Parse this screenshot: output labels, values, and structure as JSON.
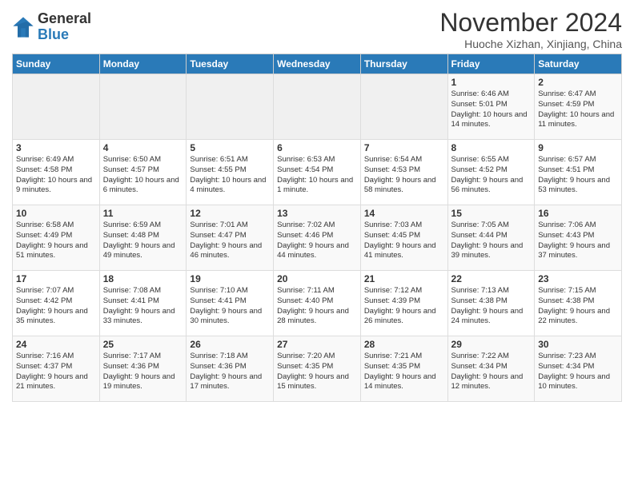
{
  "logo": {
    "general": "General",
    "blue": "Blue"
  },
  "title": "November 2024",
  "subtitle": "Huoche Xizhan, Xinjiang, China",
  "days_of_week": [
    "Sunday",
    "Monday",
    "Tuesday",
    "Wednesday",
    "Thursday",
    "Friday",
    "Saturday"
  ],
  "weeks": [
    [
      {
        "day": "",
        "info": ""
      },
      {
        "day": "",
        "info": ""
      },
      {
        "day": "",
        "info": ""
      },
      {
        "day": "",
        "info": ""
      },
      {
        "day": "",
        "info": ""
      },
      {
        "day": "1",
        "info": "Sunrise: 6:46 AM\nSunset: 5:01 PM\nDaylight: 10 hours and 14 minutes."
      },
      {
        "day": "2",
        "info": "Sunrise: 6:47 AM\nSunset: 4:59 PM\nDaylight: 10 hours and 11 minutes."
      }
    ],
    [
      {
        "day": "3",
        "info": "Sunrise: 6:49 AM\nSunset: 4:58 PM\nDaylight: 10 hours and 9 minutes."
      },
      {
        "day": "4",
        "info": "Sunrise: 6:50 AM\nSunset: 4:57 PM\nDaylight: 10 hours and 6 minutes."
      },
      {
        "day": "5",
        "info": "Sunrise: 6:51 AM\nSunset: 4:55 PM\nDaylight: 10 hours and 4 minutes."
      },
      {
        "day": "6",
        "info": "Sunrise: 6:53 AM\nSunset: 4:54 PM\nDaylight: 10 hours and 1 minute."
      },
      {
        "day": "7",
        "info": "Sunrise: 6:54 AM\nSunset: 4:53 PM\nDaylight: 9 hours and 58 minutes."
      },
      {
        "day": "8",
        "info": "Sunrise: 6:55 AM\nSunset: 4:52 PM\nDaylight: 9 hours and 56 minutes."
      },
      {
        "day": "9",
        "info": "Sunrise: 6:57 AM\nSunset: 4:51 PM\nDaylight: 9 hours and 53 minutes."
      }
    ],
    [
      {
        "day": "10",
        "info": "Sunrise: 6:58 AM\nSunset: 4:49 PM\nDaylight: 9 hours and 51 minutes."
      },
      {
        "day": "11",
        "info": "Sunrise: 6:59 AM\nSunset: 4:48 PM\nDaylight: 9 hours and 49 minutes."
      },
      {
        "day": "12",
        "info": "Sunrise: 7:01 AM\nSunset: 4:47 PM\nDaylight: 9 hours and 46 minutes."
      },
      {
        "day": "13",
        "info": "Sunrise: 7:02 AM\nSunset: 4:46 PM\nDaylight: 9 hours and 44 minutes."
      },
      {
        "day": "14",
        "info": "Sunrise: 7:03 AM\nSunset: 4:45 PM\nDaylight: 9 hours and 41 minutes."
      },
      {
        "day": "15",
        "info": "Sunrise: 7:05 AM\nSunset: 4:44 PM\nDaylight: 9 hours and 39 minutes."
      },
      {
        "day": "16",
        "info": "Sunrise: 7:06 AM\nSunset: 4:43 PM\nDaylight: 9 hours and 37 minutes."
      }
    ],
    [
      {
        "day": "17",
        "info": "Sunrise: 7:07 AM\nSunset: 4:42 PM\nDaylight: 9 hours and 35 minutes."
      },
      {
        "day": "18",
        "info": "Sunrise: 7:08 AM\nSunset: 4:41 PM\nDaylight: 9 hours and 33 minutes."
      },
      {
        "day": "19",
        "info": "Sunrise: 7:10 AM\nSunset: 4:41 PM\nDaylight: 9 hours and 30 minutes."
      },
      {
        "day": "20",
        "info": "Sunrise: 7:11 AM\nSunset: 4:40 PM\nDaylight: 9 hours and 28 minutes."
      },
      {
        "day": "21",
        "info": "Sunrise: 7:12 AM\nSunset: 4:39 PM\nDaylight: 9 hours and 26 minutes."
      },
      {
        "day": "22",
        "info": "Sunrise: 7:13 AM\nSunset: 4:38 PM\nDaylight: 9 hours and 24 minutes."
      },
      {
        "day": "23",
        "info": "Sunrise: 7:15 AM\nSunset: 4:38 PM\nDaylight: 9 hours and 22 minutes."
      }
    ],
    [
      {
        "day": "24",
        "info": "Sunrise: 7:16 AM\nSunset: 4:37 PM\nDaylight: 9 hours and 21 minutes."
      },
      {
        "day": "25",
        "info": "Sunrise: 7:17 AM\nSunset: 4:36 PM\nDaylight: 9 hours and 19 minutes."
      },
      {
        "day": "26",
        "info": "Sunrise: 7:18 AM\nSunset: 4:36 PM\nDaylight: 9 hours and 17 minutes."
      },
      {
        "day": "27",
        "info": "Sunrise: 7:20 AM\nSunset: 4:35 PM\nDaylight: 9 hours and 15 minutes."
      },
      {
        "day": "28",
        "info": "Sunrise: 7:21 AM\nSunset: 4:35 PM\nDaylight: 9 hours and 14 minutes."
      },
      {
        "day": "29",
        "info": "Sunrise: 7:22 AM\nSunset: 4:34 PM\nDaylight: 9 hours and 12 minutes."
      },
      {
        "day": "30",
        "info": "Sunrise: 7:23 AM\nSunset: 4:34 PM\nDaylight: 9 hours and 10 minutes."
      }
    ]
  ]
}
